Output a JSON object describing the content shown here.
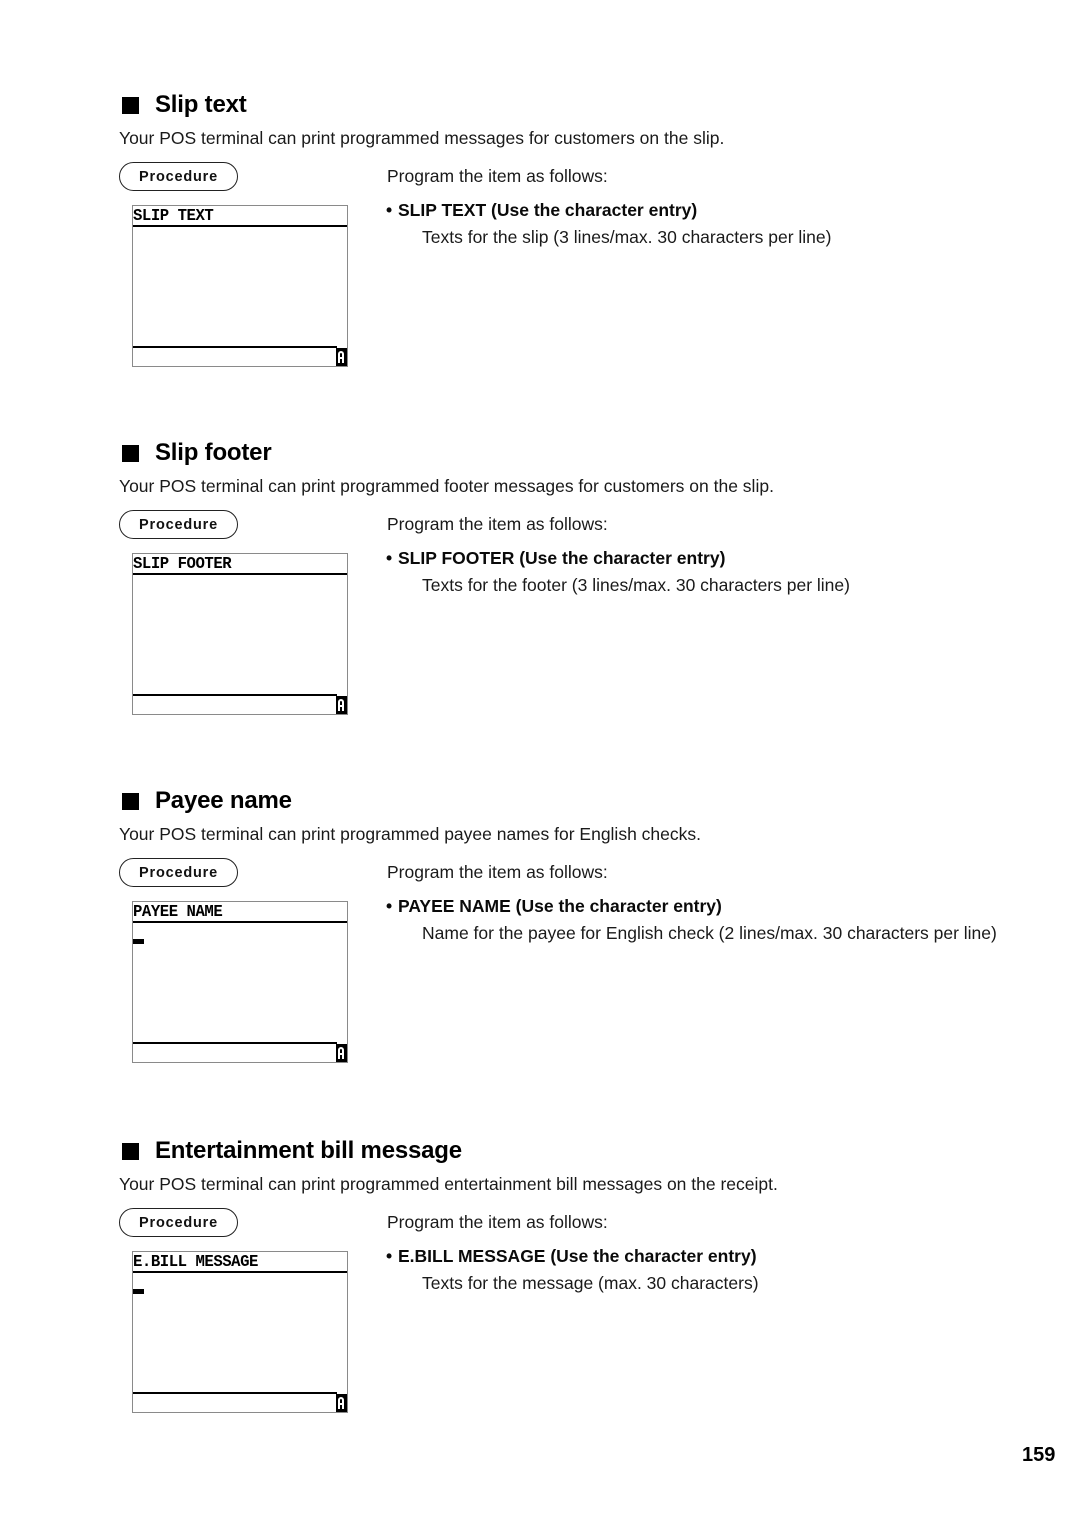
{
  "page": {
    "number": "159"
  },
  "sections": [
    {
      "heading": "Slip text",
      "intro": "Your POS terminal can print programmed messages for customers on the slip.",
      "procedure_label": "Procedure",
      "lcd": {
        "title": "SLIP TEXT",
        "cursor_visible": false,
        "mode_icon": "alpha-mode-icon"
      },
      "program_line": "Program the item as follows:",
      "item": {
        "bullet": "•",
        "label": "SLIP TEXT (Use the character entry)",
        "description": "Texts for the slip (3 lines/max. 30 characters per line)"
      }
    },
    {
      "heading": "Slip footer",
      "intro": "Your POS terminal can print programmed footer messages for customers on the slip.",
      "procedure_label": "Procedure",
      "lcd": {
        "title": "SLIP FOOTER",
        "cursor_visible": false,
        "mode_icon": "alpha-mode-icon"
      },
      "program_line": "Program the item as follows:",
      "item": {
        "bullet": "•",
        "label": "SLIP FOOTER (Use the character entry)",
        "description": "Texts for the footer (3 lines/max. 30 characters per line)"
      }
    },
    {
      "heading": "Payee name",
      "intro": "Your POS terminal can print programmed payee names for English checks.",
      "procedure_label": "Procedure",
      "lcd": {
        "title": "PAYEE NAME",
        "cursor_visible": true,
        "mode_icon": "alpha-mode-icon"
      },
      "program_line": "Program the item as follows:",
      "item": {
        "bullet": "•",
        "label": "PAYEE NAME (Use the character entry)",
        "description": "Name for the payee for English check (2 lines/max. 30 characters per line)"
      }
    },
    {
      "heading": "Entertainment bill message",
      "intro": "Your POS terminal can print programmed entertainment bill messages on the receipt.",
      "procedure_label": "Procedure",
      "lcd": {
        "title": "E.BILL MESSAGE",
        "cursor_visible": true,
        "mode_icon": "alpha-mode-icon"
      },
      "program_line": "Program the item as follows:",
      "item": {
        "bullet": "•",
        "label": "E.BILL MESSAGE (Use the character entry)",
        "description": "Texts for the message (max. 30 characters)"
      }
    }
  ]
}
